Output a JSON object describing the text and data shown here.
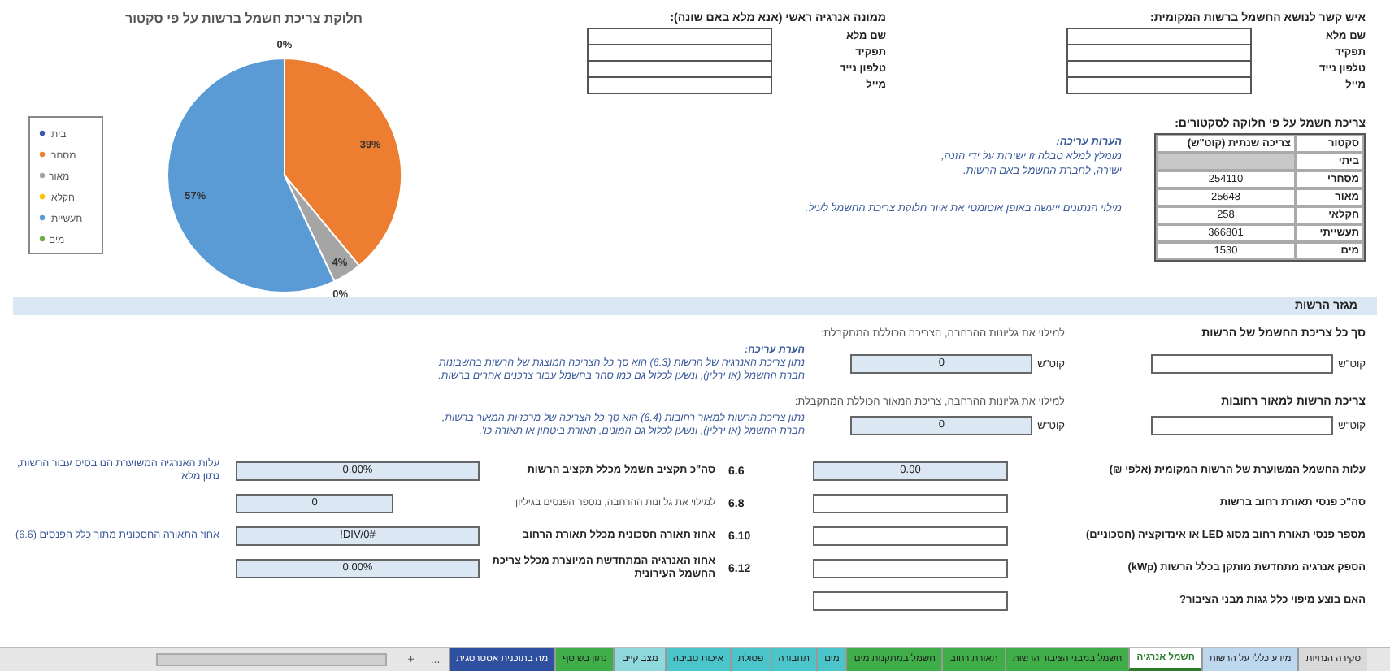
{
  "contact_person": {
    "title": "איש קשר לנושא החשמל ברשות המקומית:",
    "rows": [
      {
        "label": "שם מלא"
      },
      {
        "label": "תפקיד"
      },
      {
        "label": "טלפון נייד"
      },
      {
        "label": "מייל"
      }
    ]
  },
  "energy_manager": {
    "title": "ממונה אנרגיה ראשי (אנא מלא באם שונה):",
    "rows": [
      {
        "label": "שם מלא"
      },
      {
        "label": "תפקיד"
      },
      {
        "label": "טלפון נייד"
      },
      {
        "label": "מייל"
      }
    ]
  },
  "sector_table": {
    "title": "צריכת חשמל על פי חלוקה לסקטורים:",
    "columns": [
      "סקטור",
      "צריכה שנתית (קוט\"ש)"
    ],
    "rows": [
      {
        "sector": "ביתי"
      },
      {
        "sector": "מסחרי",
        "value": "254110"
      },
      {
        "sector": "מאור",
        "value": "25648"
      },
      {
        "sector": "חקלאי",
        "value": "258"
      },
      {
        "sector": "תעשייתי",
        "value": "366801"
      },
      {
        "sector": "מים",
        "value": "1530"
      }
    ]
  },
  "editing_notes": {
    "title": "הערות עריכה:",
    "lines": [
      "מומלץ למלא טבלה זו ישירות על ידי הזנה,",
      "ישירה, לחברת החשמל באם הרשות."
    ],
    "footer": "מילוי הנתונים ייעשה באופן אוטומטי את איור חלוקת צריכת החשמל לעיל."
  },
  "chart_panel": {
    "chart_data": {
      "type": "pie",
      "title": "חלוקת צריכת חשמל ברשות על פי סקטור",
      "categories": [
        "ביתי",
        "מסחרי",
        "מאור",
        "חקלאי",
        "תעשייתי",
        "מים"
      ],
      "series": [
        {
          "values": [
            null,
            39,
            4,
            0,
            57,
            0
          ]
        }
      ],
      "value_labels": [
        null,
        "39%",
        "4%",
        "0%",
        "57%",
        "0%"
      ],
      "legend": "left"
    }
  },
  "section_band": "מגזר הרשות",
  "consumption_rows": [
    {
      "label": "סך כל צריכת החשמל של הרשות",
      "unit": "קוט\"ש",
      "auto_label": "למילוי את גליונות ההרחבה, הצריכה הכוללת המתקבלת:",
      "auto_value": "0",
      "auto_unit": "קוט\"ש",
      "note_title": "הערת עריכה:",
      "note_lines": [
        "נתון צריכת האנרגיה של הרשות (6.3) הוא סך כל הצריכה המוצגת של הרשות בחשבונות",
        "חברת החשמל (או ירלין), ונשען לכלול גם כמו סחר בחשמל עבור צרכנים אחרים ברשות."
      ]
    },
    {
      "label": "צריכת הרשות למאור רחובות",
      "unit": "קוט\"ש",
      "auto_label": "למילוי את גליונות ההרחבה, צריכת המאור הכוללת המתקבלת:",
      "auto_value": "0",
      "auto_unit": "קוט\"ש",
      "note_lines": [
        "נתון צריכת הרשות למאור רחובות (6.4) הוא סך כל הצריכה של מרכזיות המאור ברשות,",
        "חברת החשמל (או ירלין), ונשען לכלול גם המונים, תאורת ביטחון או תאורה כו'."
      ]
    }
  ],
  "indicators": [
    {
      "label": "עלות החשמל המשוערת של הרשות המקומית (אלפי ₪)",
      "value": "0.00",
      "code": "6.6",
      "calc_label": "סה\"כ תקציב חשמל מכלל תקציב הרשות",
      "calc_value": "0.00%",
      "note": "עלות האנרגיה המשוערת הנו בסיס עבור הרשות, נתון מלא"
    },
    {
      "label": "סה\"כ פנסי תאורת רחוב ברשות",
      "code": "6.8",
      "calc_label": "למילוי את גליונות ההרחבה, מספר הפנסים בגיליון",
      "calc_value": "0",
      "calc_plain": true
    },
    {
      "label": "מספר פנסי תאורת רחוב מסוג LED או אינדוקציה (חסכוניים)",
      "code": "6.10",
      "calc_label": "אחוז תאורה חסכונית מכלל תאורת הרחוב",
      "calc_value": "#DIV/0!",
      "note": "אחוז התאורה החסכונית מתוך כלל הפנסים (6.6)"
    },
    {
      "label": "הספק אנרגיה מתחדשת מותקן בכלל הרשות (kWp)",
      "code": "6.12",
      "calc_label": "אחוז האנרגיה המתחדשת המיוצרת מכלל צריכת החשמל העירונית",
      "calc_value": "0.00%"
    },
    {
      "label": "האם בוצע מיפוי כלל גגות מבני הציבור?"
    }
  ],
  "sheet_tabs": [
    {
      "label": "סקירה הנחיות",
      "color": "#d9d9d9",
      "selected": false
    },
    {
      "label": "מידע כללי על הרשות",
      "color": "#bdd7ee",
      "selected": false
    },
    {
      "label": "חשמל אנרגיה",
      "color": "#ffffff",
      "selected": true
    },
    {
      "label": "חשמל במבני הציבור הרשות",
      "color": "#3fae49",
      "selected": false
    },
    {
      "label": "תאורת רחוב",
      "color": "#3fae49",
      "selected": false
    },
    {
      "label": "חשמל במתקנות מים",
      "color": "#3fae49",
      "selected": false
    },
    {
      "label": "מים",
      "color": "#4bc5c9",
      "selected": false
    },
    {
      "label": "תחבורה",
      "color": "#4bc5c9",
      "selected": false
    },
    {
      "label": "פסולת",
      "color": "#4bc5c9",
      "selected": false
    },
    {
      "label": "איכות סביבה",
      "color": "#4bc5c9",
      "selected": false
    },
    {
      "label": "מצב קיים",
      "color": "#8fd8dc",
      "selected": false
    },
    {
      "label": "נתון בשוטף",
      "color": "#3fae49",
      "selected": false
    },
    {
      "label": "מה בתוכנית אסטרטגית",
      "color": "#2f4f9f",
      "selected": false
    }
  ],
  "tab_controls": [
    "...",
    "+"
  ]
}
